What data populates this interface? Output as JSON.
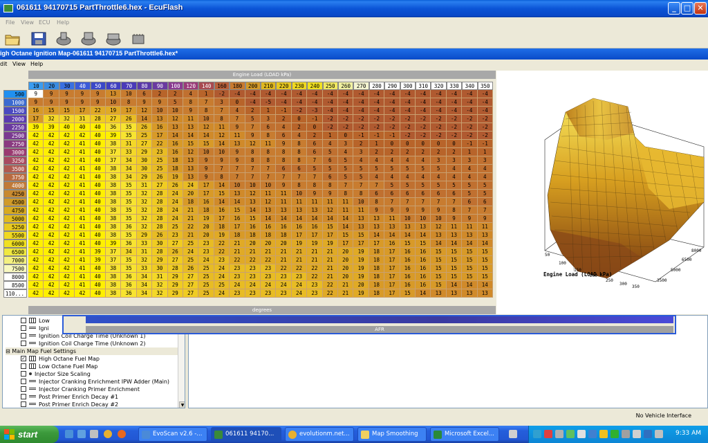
{
  "window": {
    "title": "061611 94170715 PartThrottle6.hex - EcuFlash"
  },
  "menu": [
    "File",
    "View",
    "ECU",
    "Help"
  ],
  "inner": {
    "title": "igh Octane Ignition Map-061611 94170715 PartThrottle6.hex*",
    "menu": [
      "dit",
      "View",
      "Help"
    ]
  },
  "table": {
    "col_axis_label": "Engine Load (LOAD kPa)",
    "bottom_label": "degrees",
    "columns": [
      "10",
      "20",
      "30",
      "40",
      "50",
      "60",
      "70",
      "80",
      "90",
      "100",
      "120",
      "140",
      "160",
      "180",
      "200",
      "210",
      "220",
      "230",
      "240",
      "250",
      "260",
      "270",
      "280",
      "290",
      "300",
      "310",
      "320",
      "330",
      "340",
      "350"
    ],
    "column_colors": [
      "#3a9cf0",
      "#3a8ce0",
      "#3a70e0",
      "#3a5ad8",
      "#3a48c8",
      "#4040c0",
      "#4a3ab8",
      "#5a3aa8",
      "#6a3aa0",
      "#8a3a90",
      "#9a3a78",
      "#a84a50",
      "#b8603a",
      "#c87a30",
      "#d49a28",
      "#e0b820",
      "#e8c820",
      "#f0d820",
      "#f0e020",
      "#f0e860",
      "#f0f0a0",
      "#f4f4d0",
      "#ffffff",
      "#ffffff",
      "#ffffff",
      "#ffffff",
      "#ffffff",
      "#ffffff",
      "#ffffff",
      "#ffffff"
    ],
    "rows": [
      "500",
      "1000",
      "1500",
      "2000",
      "2250",
      "2500",
      "2750",
      "3000",
      "3250",
      "3500",
      "3750",
      "4000",
      "4250",
      "4500",
      "4750",
      "5000",
      "5250",
      "5500",
      "6000",
      "6500",
      "7000",
      "7500",
      "8000",
      "8500",
      "110..."
    ],
    "row_colors": [
      "#2090f0",
      "#3a6ad0",
      "#4a4ac0",
      "#5a3ab0",
      "#6a3aa0",
      "#7a3a90",
      "#8a3a80",
      "#9a3a70",
      "#a84a60",
      "#b05a50",
      "#b86a40",
      "#c07a38",
      "#c88a30",
      "#d09a28",
      "#d8aa20",
      "#e0ba20",
      "#e8ca20",
      "#f0d820",
      "#f0e020",
      "#f0e840",
      "#f4f080",
      "#f8f8c0",
      "#ffffff",
      "#ffffff",
      "#ffffff"
    ],
    "values": [
      [
        "9",
        "9",
        "9",
        "9",
        "9",
        "13",
        "10",
        "6",
        "2",
        "2",
        "4",
        "1",
        "-2",
        "-4",
        "-4",
        "-4",
        "-4",
        "-4",
        "-4",
        "-4",
        "-4",
        "-4",
        "-4",
        "-4",
        "-4",
        "-4",
        "-4",
        "-4",
        "-4",
        "-4"
      ],
      [
        "9",
        "9",
        "9",
        "9",
        "9",
        "10",
        "8",
        "9",
        "9",
        "5",
        "8",
        "7",
        "3",
        "0",
        "-4",
        "-5",
        "-4",
        "-4",
        "-4",
        "-4",
        "-4",
        "-4",
        "-4",
        "-4",
        "-4",
        "-4",
        "-4",
        "-4",
        "-4",
        "-4"
      ],
      [
        "16",
        "15",
        "15",
        "17",
        "22",
        "19",
        "17",
        "12",
        "10",
        "10",
        "9",
        "8",
        "7",
        "4",
        "2",
        "1",
        "-1",
        "-2",
        "-3",
        "-4",
        "-4",
        "-4",
        "-4",
        "-4",
        "-4",
        "-4",
        "-4",
        "-4",
        "-4",
        "-4"
      ],
      [
        "17",
        "32",
        "32",
        "31",
        "28",
        "27",
        "26",
        "14",
        "13",
        "12",
        "11",
        "10",
        "8",
        "7",
        "5",
        "3",
        "2",
        "0",
        "-1",
        "-2",
        "-2",
        "-2",
        "-2",
        "-2",
        "-2",
        "-2",
        "-2",
        "-2",
        "-2",
        "-2"
      ],
      [
        "39",
        "39",
        "40",
        "40",
        "40",
        "36",
        "35",
        "26",
        "16",
        "13",
        "13",
        "12",
        "11",
        "9",
        "7",
        "6",
        "4",
        "2",
        "0",
        "-2",
        "-2",
        "-2",
        "-2",
        "-2",
        "-2",
        "-2",
        "-2",
        "-2",
        "-2",
        "-2"
      ],
      [
        "42",
        "42",
        "42",
        "42",
        "40",
        "39",
        "35",
        "25",
        "17",
        "14",
        "14",
        "14",
        "12",
        "11",
        "9",
        "8",
        "6",
        "4",
        "2",
        "1",
        "0",
        "-1",
        "-1",
        "-1",
        "-2",
        "-2",
        "-2",
        "-2",
        "-2",
        "-2"
      ],
      [
        "42",
        "42",
        "42",
        "41",
        "40",
        "38",
        "31",
        "27",
        "22",
        "16",
        "15",
        "15",
        "14",
        "13",
        "12",
        "11",
        "9",
        "8",
        "6",
        "4",
        "3",
        "2",
        "1",
        "0",
        "0",
        "0",
        "0",
        "0",
        "-1",
        "-1"
      ],
      [
        "42",
        "42",
        "42",
        "41",
        "40",
        "37",
        "33",
        "29",
        "23",
        "16",
        "12",
        "10",
        "10",
        "9",
        "8",
        "8",
        "8",
        "8",
        "6",
        "5",
        "4",
        "3",
        "2",
        "2",
        "2",
        "2",
        "2",
        "2",
        "1",
        "1"
      ],
      [
        "42",
        "42",
        "42",
        "41",
        "40",
        "37",
        "34",
        "30",
        "25",
        "18",
        "13",
        "9",
        "9",
        "9",
        "8",
        "8",
        "8",
        "8",
        "7",
        "6",
        "5",
        "4",
        "4",
        "4",
        "4",
        "4",
        "3",
        "3",
        "3",
        "3"
      ],
      [
        "42",
        "42",
        "42",
        "41",
        "40",
        "38",
        "34",
        "30",
        "25",
        "18",
        "13",
        "9",
        "7",
        "7",
        "7",
        "7",
        "6",
        "6",
        "5",
        "5",
        "5",
        "5",
        "5",
        "5",
        "5",
        "5",
        "5",
        "4",
        "4",
        "4"
      ],
      [
        "42",
        "42",
        "42",
        "41",
        "40",
        "38",
        "34",
        "29",
        "26",
        "19",
        "13",
        "9",
        "8",
        "7",
        "7",
        "7",
        "7",
        "7",
        "7",
        "6",
        "5",
        "5",
        "4",
        "4",
        "4",
        "4",
        "4",
        "4",
        "4",
        "4"
      ],
      [
        "42",
        "42",
        "42",
        "41",
        "40",
        "38",
        "35",
        "31",
        "27",
        "26",
        "24",
        "17",
        "14",
        "10",
        "10",
        "10",
        "9",
        "8",
        "8",
        "8",
        "7",
        "7",
        "7",
        "5",
        "5",
        "5",
        "5",
        "5",
        "5",
        "5"
      ],
      [
        "42",
        "42",
        "42",
        "41",
        "40",
        "38",
        "35",
        "32",
        "28",
        "24",
        "20",
        "17",
        "15",
        "13",
        "12",
        "11",
        "11",
        "10",
        "9",
        "9",
        "8",
        "8",
        "6",
        "6",
        "6",
        "6",
        "6",
        "6",
        "5",
        "5"
      ],
      [
        "42",
        "42",
        "42",
        "41",
        "40",
        "38",
        "35",
        "32",
        "28",
        "24",
        "18",
        "16",
        "14",
        "14",
        "13",
        "12",
        "11",
        "11",
        "11",
        "11",
        "11",
        "10",
        "8",
        "7",
        "7",
        "7",
        "7",
        "7",
        "6",
        "6"
      ],
      [
        "42",
        "42",
        "42",
        "41",
        "40",
        "38",
        "35",
        "32",
        "28",
        "24",
        "21",
        "18",
        "16",
        "15",
        "14",
        "13",
        "13",
        "13",
        "13",
        "12",
        "11",
        "11",
        "9",
        "9",
        "9",
        "9",
        "9",
        "8",
        "7",
        "7"
      ],
      [
        "42",
        "42",
        "42",
        "41",
        "40",
        "38",
        "35",
        "32",
        "28",
        "24",
        "21",
        "19",
        "17",
        "16",
        "15",
        "14",
        "14",
        "14",
        "14",
        "14",
        "14",
        "13",
        "13",
        "11",
        "10",
        "10",
        "10",
        "9",
        "9",
        "9"
      ],
      [
        "42",
        "42",
        "42",
        "41",
        "40",
        "38",
        "36",
        "32",
        "28",
        "25",
        "22",
        "20",
        "18",
        "17",
        "16",
        "16",
        "16",
        "16",
        "16",
        "15",
        "14",
        "13",
        "13",
        "13",
        "13",
        "13",
        "12",
        "11",
        "11",
        "11"
      ],
      [
        "42",
        "42",
        "42",
        "41",
        "40",
        "38",
        "35",
        "29",
        "26",
        "23",
        "21",
        "20",
        "19",
        "18",
        "18",
        "18",
        "18",
        "17",
        "17",
        "17",
        "15",
        "15",
        "14",
        "14",
        "14",
        "14",
        "13",
        "13",
        "13",
        "13"
      ],
      [
        "42",
        "42",
        "42",
        "41",
        "40",
        "39",
        "36",
        "33",
        "30",
        "27",
        "25",
        "23",
        "22",
        "21",
        "20",
        "20",
        "20",
        "19",
        "19",
        "19",
        "17",
        "17",
        "17",
        "16",
        "15",
        "15",
        "14",
        "14",
        "14",
        "14"
      ],
      [
        "42",
        "42",
        "42",
        "41",
        "39",
        "37",
        "34",
        "31",
        "28",
        "26",
        "24",
        "23",
        "22",
        "21",
        "21",
        "21",
        "21",
        "21",
        "21",
        "21",
        "20",
        "19",
        "18",
        "17",
        "16",
        "16",
        "15",
        "15",
        "15",
        "15"
      ],
      [
        "42",
        "42",
        "42",
        "41",
        "39",
        "37",
        "35",
        "32",
        "29",
        "27",
        "25",
        "24",
        "23",
        "22",
        "22",
        "22",
        "21",
        "21",
        "21",
        "21",
        "20",
        "19",
        "18",
        "17",
        "16",
        "16",
        "15",
        "15",
        "15",
        "15"
      ],
      [
        "42",
        "42",
        "42",
        "41",
        "40",
        "38",
        "35",
        "33",
        "30",
        "28",
        "26",
        "25",
        "24",
        "23",
        "23",
        "23",
        "22",
        "22",
        "22",
        "21",
        "20",
        "19",
        "18",
        "17",
        "16",
        "16",
        "15",
        "15",
        "15",
        "15"
      ],
      [
        "42",
        "42",
        "42",
        "41",
        "40",
        "38",
        "36",
        "34",
        "31",
        "29",
        "27",
        "25",
        "24",
        "23",
        "23",
        "23",
        "23",
        "23",
        "22",
        "21",
        "20",
        "19",
        "18",
        "17",
        "16",
        "16",
        "15",
        "15",
        "15",
        "15"
      ],
      [
        "42",
        "42",
        "42",
        "41",
        "40",
        "38",
        "36",
        "34",
        "32",
        "29",
        "27",
        "25",
        "25",
        "24",
        "24",
        "24",
        "24",
        "24",
        "23",
        "22",
        "21",
        "20",
        "18",
        "17",
        "16",
        "16",
        "15",
        "14",
        "14",
        "14"
      ],
      [
        "42",
        "42",
        "42",
        "42",
        "40",
        "38",
        "36",
        "34",
        "32",
        "29",
        "27",
        "25",
        "24",
        "23",
        "23",
        "23",
        "23",
        "24",
        "23",
        "22",
        "21",
        "19",
        "18",
        "17",
        "15",
        "14",
        "13",
        "13",
        "13",
        "13"
      ]
    ]
  },
  "plot": {
    "axis_label": "Engine Load (LOAD kPa)",
    "ticks_left": [
      "50",
      "100",
      "150",
      "200",
      "250",
      "300",
      "350"
    ],
    "ticks_right": [
      "3500",
      "5000",
      "6500",
      "8000"
    ]
  },
  "afr_label": "AFR",
  "tree": {
    "items": [
      {
        "label": "Low",
        "checked": false,
        "icon": "table"
      },
      {
        "label": "Igni",
        "checked": false,
        "icon": "line"
      },
      {
        "label": "Ignition Coil Charge Time (Unknown 1)",
        "checked": false,
        "icon": "line"
      },
      {
        "label": "Ignition Coil Charge Time (Unknown 2)",
        "checked": false,
        "icon": "line"
      },
      {
        "label": "Main Map Fuel Settings",
        "group": true
      },
      {
        "label": "High Octane Fuel Map",
        "checked": true,
        "icon": "table"
      },
      {
        "label": "Low Octane Fuel Map",
        "checked": false,
        "icon": "table"
      },
      {
        "label": "Injector Size Scaling",
        "checked": false,
        "icon": "dot"
      },
      {
        "label": "Injector Cranking Enrichment IPW Adder (Main)",
        "checked": false,
        "icon": "line"
      },
      {
        "label": "Injector Cranking Primer Enrichment",
        "checked": false,
        "icon": "line"
      },
      {
        "label": "Post Primer Enrich Decay #1",
        "checked": false,
        "icon": "line"
      },
      {
        "label": "Post Primer Enrich Decay #2",
        "checked": false,
        "icon": "line"
      }
    ]
  },
  "status": "No Vehicle Interface",
  "taskbar": {
    "start": "start",
    "buttons": [
      "EvoScan v2.6 -...",
      "061611 94170...",
      "evolutionm.net...",
      "Map Smoothing",
      "Microsoft Excel..."
    ],
    "clock": "9:33 AM"
  }
}
